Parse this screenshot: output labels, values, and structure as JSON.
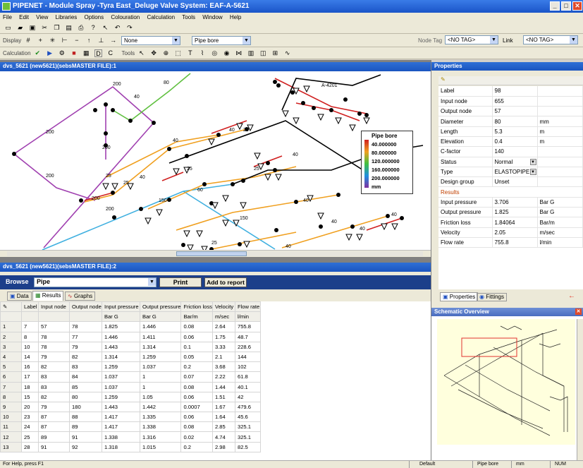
{
  "window": {
    "title": "PIPENET - Module Spray -Tyra East_Deluge Valve System: EAF-A-5621",
    "min": "_",
    "max": "□",
    "close": "✕"
  },
  "menu": [
    "File",
    "Edit",
    "View",
    "Libraries",
    "Options",
    "Colouration",
    "Calculation",
    "Tools",
    "Window",
    "Help"
  ],
  "toolbar": {
    "display_label": "Display",
    "calculation_label": "Calculation",
    "tools_label": "Tools",
    "display_combo": "None",
    "colour_combo": "Pipe bore",
    "node_tag_label": "Node Tag",
    "node_tag_value": "<NO TAG>",
    "link_label": "Link",
    "link_value": "<NO TAG>"
  },
  "graph_window": {
    "title": "dvs_5621 (new5621)(sebsMASTER FILE):1",
    "node_label": "A-4201",
    "legend": {
      "title": "Pipe bore",
      "unit": "mm",
      "entries": [
        {
          "value": "40.000000",
          "color": "#d02020"
        },
        {
          "value": "80.000000",
          "color": "#f0a020"
        },
        {
          "value": "120.000000",
          "color": "#40c040"
        },
        {
          "value": "160.000000",
          "color": "#2090e0"
        },
        {
          "value": "200.000000",
          "color": "#8030a0"
        }
      ]
    }
  },
  "properties": {
    "title": "Properties",
    "rows": [
      {
        "k": "Label",
        "v": "98",
        "u": ""
      },
      {
        "k": "Input node",
        "v": "655",
        "u": ""
      },
      {
        "k": "Output node",
        "v": "57",
        "u": ""
      },
      {
        "k": "Diameter",
        "v": "80",
        "u": "mm"
      },
      {
        "k": "Length",
        "v": "5.3",
        "u": "m"
      },
      {
        "k": "Elevation",
        "v": "0.4",
        "u": "m"
      },
      {
        "k": "C-factor",
        "v": "140",
        "u": ""
      },
      {
        "k": "Status",
        "v": "Normal",
        "u": ""
      },
      {
        "k": "Type",
        "v": "ELASTOPIPE",
        "u": ""
      },
      {
        "k": "Design group",
        "v": "Unset",
        "u": ""
      }
    ],
    "results_label": "Results",
    "results": [
      {
        "k": "Input pressure",
        "v": "3.706",
        "u": "Bar G"
      },
      {
        "k": "Output pressure",
        "v": "1.825",
        "u": "Bar G"
      },
      {
        "k": "Friction loss",
        "v": "1.84064",
        "u": "Bar/m"
      },
      {
        "k": "Velocity",
        "v": "2.05",
        "u": "m/sec"
      },
      {
        "k": "Flow rate",
        "v": "755.8",
        "u": "l/min"
      }
    ],
    "tab_properties": "Properties",
    "tab_fittings": "Fittings"
  },
  "schematic": {
    "title": "Schematic Overview"
  },
  "results_window": {
    "title": "dvs_5621 (new5621)(sebsMASTER FILE):2",
    "browse_label": "Browse",
    "browse_value": "Pipe",
    "print_button": "Print",
    "add_report_button": "Add to report",
    "tabs": [
      "Data",
      "Results",
      "Graphs"
    ],
    "columns": [
      "Label",
      "Input node",
      "Output node",
      "Input pressure",
      "Output pressure",
      "Friction loss",
      "Velocity",
      "Flow rate"
    ],
    "units": [
      "",
      "",
      "",
      "Bar G",
      "Bar G",
      "Bar/m",
      "m/sec",
      "l/min"
    ],
    "rows": [
      [
        "1",
        "7",
        "57",
        "78",
        "1.825",
        "1.446",
        "0.08",
        "2.64",
        "755.8"
      ],
      [
        "2",
        "8",
        "78",
        "77",
        "1.446",
        "1.411",
        "0.06",
        "1.75",
        "48.7"
      ],
      [
        "3",
        "10",
        "78",
        "79",
        "1.443",
        "1.314",
        "0.1",
        "3.33",
        "228.6"
      ],
      [
        "4",
        "14",
        "79",
        "82",
        "1.314",
        "1.259",
        "0.05",
        "2.1",
        "144"
      ],
      [
        "5",
        "16",
        "82",
        "83",
        "1.259",
        "1.037",
        "0.2",
        "3.68",
        "102"
      ],
      [
        "6",
        "17",
        "83",
        "84",
        "1.037",
        "1",
        "0.07",
        "2.22",
        "61.8"
      ],
      [
        "7",
        "18",
        "83",
        "85",
        "1.037",
        "1",
        "0.08",
        "1.44",
        "40.1"
      ],
      [
        "8",
        "15",
        "82",
        "80",
        "1.259",
        "1.05",
        "0.06",
        "1.51",
        "42"
      ],
      [
        "9",
        "20",
        "79",
        "180",
        "1.443",
        "1.442",
        "0.0007",
        "1.67",
        "479.6"
      ],
      [
        "10",
        "23",
        "87",
        "88",
        "1.417",
        "1.335",
        "0.06",
        "1.64",
        "45.6"
      ],
      [
        "11",
        "24",
        "87",
        "89",
        "1.417",
        "1.338",
        "0.08",
        "2.85",
        "325.1"
      ],
      [
        "12",
        "25",
        "89",
        "91",
        "1.338",
        "1.316",
        "0.02",
        "4.74",
        "325.1"
      ],
      [
        "13",
        "28",
        "91",
        "92",
        "1.318",
        "1.015",
        "0.2",
        "2.98",
        "82.5"
      ]
    ]
  },
  "statusbar": {
    "help": "For Help, press F1",
    "mode": "Default",
    "coloured_by": "Pipe bore",
    "unit": "mm",
    "num": "NUM"
  }
}
